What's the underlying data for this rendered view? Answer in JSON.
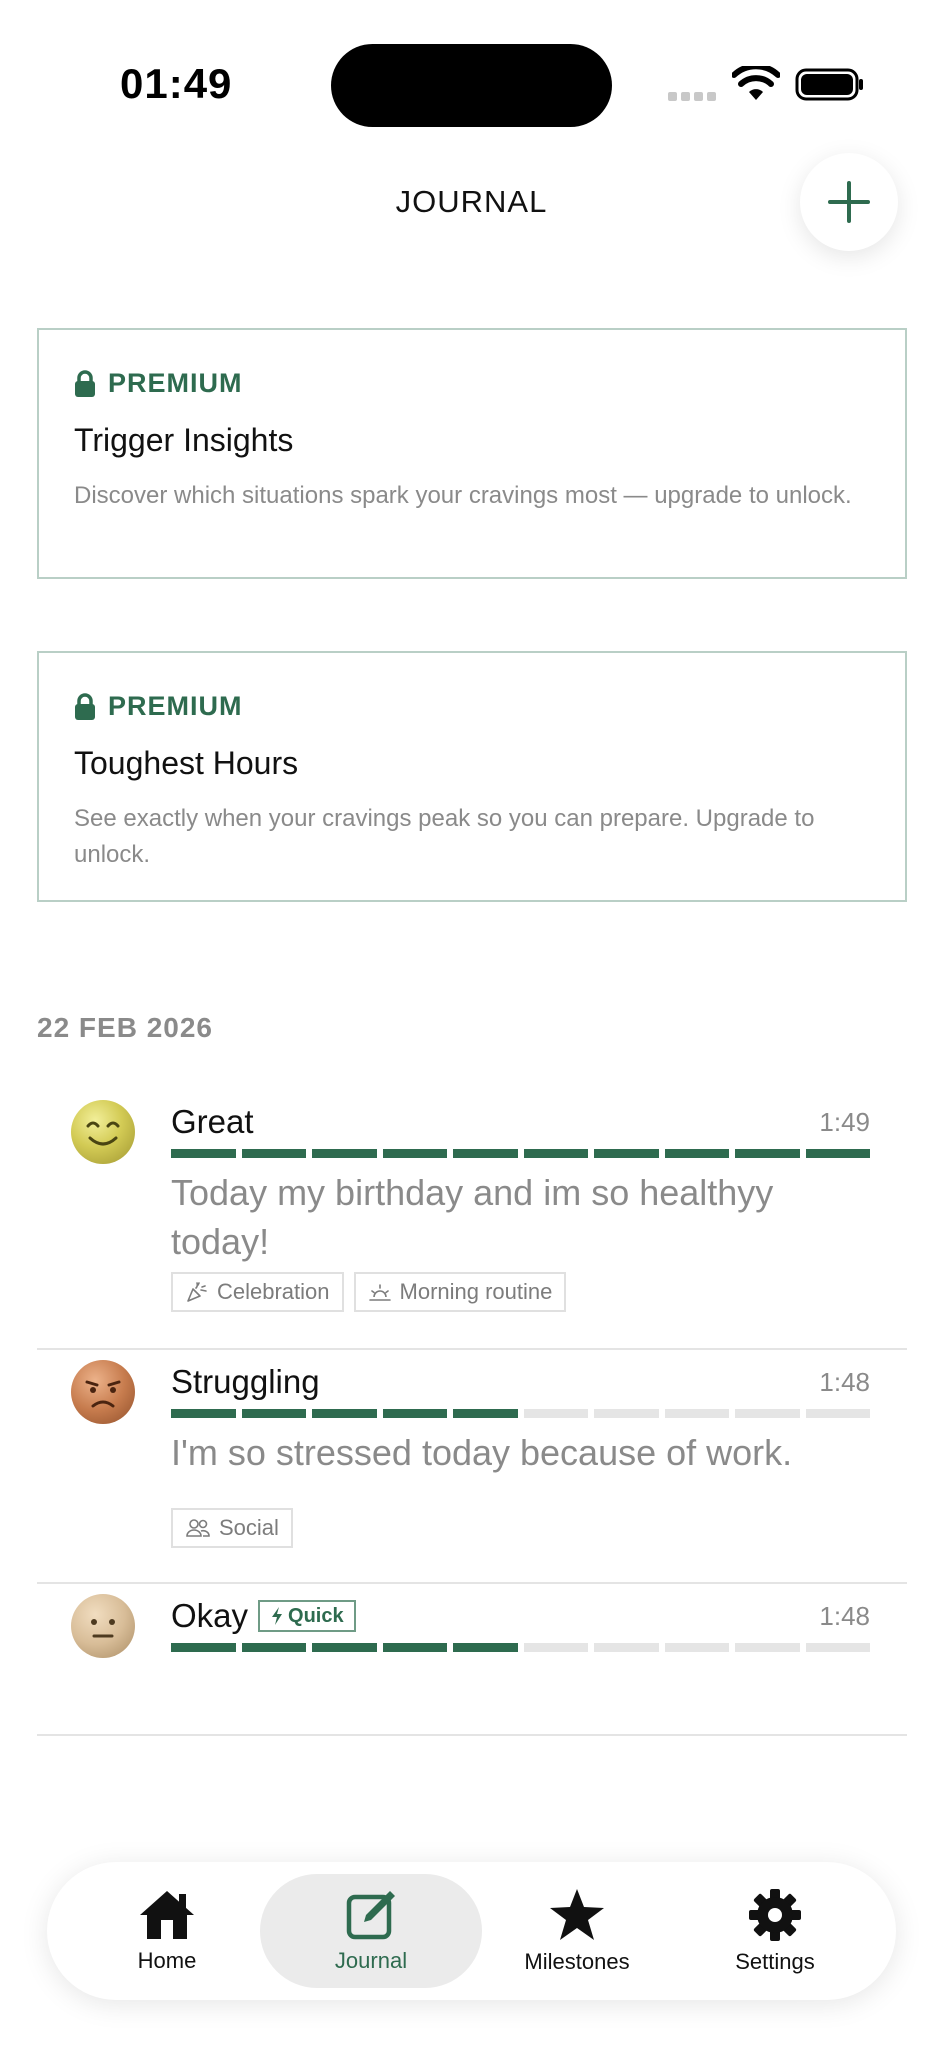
{
  "status_bar": {
    "time": "01:49"
  },
  "header": {
    "title": "JOURNAL",
    "add_icon": "plus-icon"
  },
  "premium_cards": [
    {
      "badge": "PREMIUM",
      "title": "Trigger Insights",
      "description": "Discover which situations spark your cravings most — upgrade to unlock."
    },
    {
      "badge": "PREMIUM",
      "title": "Toughest Hours",
      "description": "See exactly when your cravings peak so you can prepare. Upgrade to unlock."
    }
  ],
  "date_group": "22 FEB 2026",
  "entries": [
    {
      "mood": "Great",
      "time": "1:49",
      "mood_level": 10,
      "mood_max": 10,
      "text": "Today my birthday and im so healthyy today!",
      "tags": [
        {
          "icon": "party-popper-icon",
          "label": "Celebration"
        },
        {
          "icon": "sunrise-icon",
          "label": "Morning routine"
        }
      ]
    },
    {
      "mood": "Struggling",
      "time": "1:48",
      "mood_level": 5,
      "mood_max": 10,
      "text": "I'm so stressed today because of work.",
      "tags": [
        {
          "icon": "people-icon",
          "label": "Social"
        }
      ]
    },
    {
      "mood": "Okay",
      "quick_badge": "Quick",
      "time": "1:48",
      "mood_level": 5,
      "mood_max": 10
    }
  ],
  "nav": {
    "items": [
      {
        "label": "Home",
        "icon": "home-icon"
      },
      {
        "label": "Journal",
        "icon": "journal-edit-icon",
        "active": true
      },
      {
        "label": "Milestones",
        "icon": "star-icon"
      },
      {
        "label": "Settings",
        "icon": "gear-icon"
      }
    ]
  },
  "colors": {
    "accent": "#2e6b4f",
    "card_border": "#b9cfc6",
    "muted_text": "#8a8a8a",
    "bar_off": "#e5e5e5"
  }
}
